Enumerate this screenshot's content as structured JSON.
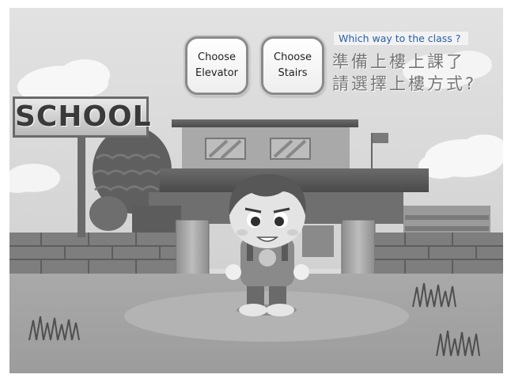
{
  "choices": [
    {
      "line1": "Choose",
      "line2": "Elevator"
    },
    {
      "line1": "Choose",
      "line2": "Stairs"
    }
  ],
  "prompt": {
    "english": "Which way to the class ?",
    "chinese_line1": "準備上樓上課了",
    "chinese_line2": "請選擇上樓方式?"
  },
  "scene": {
    "sign_text": "SCHOOL"
  }
}
